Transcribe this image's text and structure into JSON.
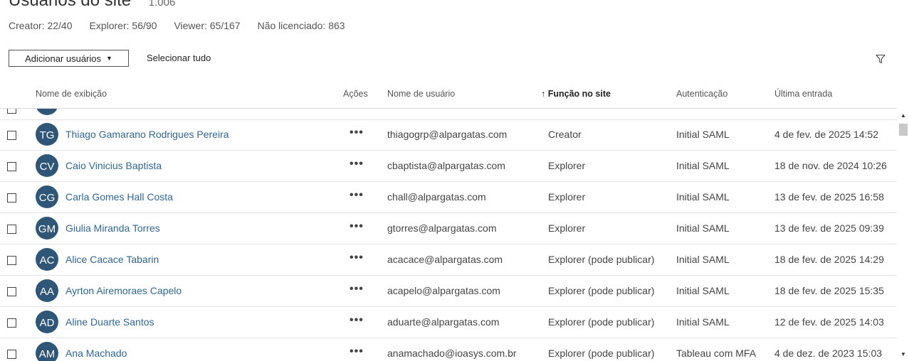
{
  "page": {
    "title": "Usuários do site",
    "user_count": "1.006"
  },
  "licenses": [
    "Creator: 22/40",
    "Explorer: 56/90",
    "Viewer: 65/167",
    "Não licenciado: 863"
  ],
  "toolbar": {
    "add_users_label": "Adicionar usuários",
    "select_all_label": "Selecionar tudo",
    "filter_icon": "filter-icon"
  },
  "table": {
    "headers": {
      "display_name": "Nome de exibição",
      "actions": "Ações",
      "username": "Nome de usuário",
      "site_role": "Função no site",
      "authentication": "Autenticação",
      "last_login": "Última entrada"
    },
    "sort_indicator": "↑",
    "rows": [
      {
        "initials": "TG",
        "name": "Thiago Gamarano Rodrigues Pereira",
        "actions": "•••",
        "username": "thiagogrp@alpargatas.com",
        "role": "Creator",
        "auth": "Initial SAML",
        "last_login": "4 de fev. de 2025 14:52"
      },
      {
        "initials": "CV",
        "name": "Caio Vinicius Baptista",
        "actions": "•••",
        "username": "cbaptista@alpargatas.com",
        "role": "Explorer",
        "auth": "Initial SAML",
        "last_login": "18 de nov. de 2024 10:26"
      },
      {
        "initials": "CG",
        "name": "Carla Gomes Hall Costa",
        "actions": "•••",
        "username": "chall@alpargatas.com",
        "role": "Explorer",
        "auth": "Initial SAML",
        "last_login": "13 de fev. de 2025 16:58"
      },
      {
        "initials": "GM",
        "name": "Giulia Miranda Torres",
        "actions": "•••",
        "username": "gtorres@alpargatas.com",
        "role": "Explorer",
        "auth": "Initial SAML",
        "last_login": "13 de fev. de 2025 09:39"
      },
      {
        "initials": "AC",
        "name": "Alice Cacace Tabarin",
        "actions": "•••",
        "username": "acacace@alpargatas.com",
        "role": "Explorer (pode publicar)",
        "auth": "Initial SAML",
        "last_login": "18 de fev. de 2025 14:29"
      },
      {
        "initials": "AA",
        "name": "Ayrton Airemoraes Capelo",
        "actions": "•••",
        "username": "acapelo@alpargatas.com",
        "role": "Explorer (pode publicar)",
        "auth": "Initial SAML",
        "last_login": "18 de fev. de 2025 15:35"
      },
      {
        "initials": "AD",
        "name": "Aline Duarte Santos",
        "actions": "•••",
        "username": "aduarte@alpargatas.com",
        "role": "Explorer (pode publicar)",
        "auth": "Initial SAML",
        "last_login": "12 de fev. de 2025 14:03"
      },
      {
        "initials": "AM",
        "name": "Ana Machado",
        "actions": "•••",
        "username": "anamachado@ioasys.com.br",
        "role": "Explorer (pode publicar)",
        "auth": "Tableau com MFA",
        "last_login": "4 de dez. de 2023 15:03"
      }
    ]
  },
  "colors": {
    "avatar_bg": "#2e5777",
    "name_link": "#2e6797"
  },
  "scrollbar": {
    "up_glyph": "▲",
    "down_glyph": "▼"
  }
}
